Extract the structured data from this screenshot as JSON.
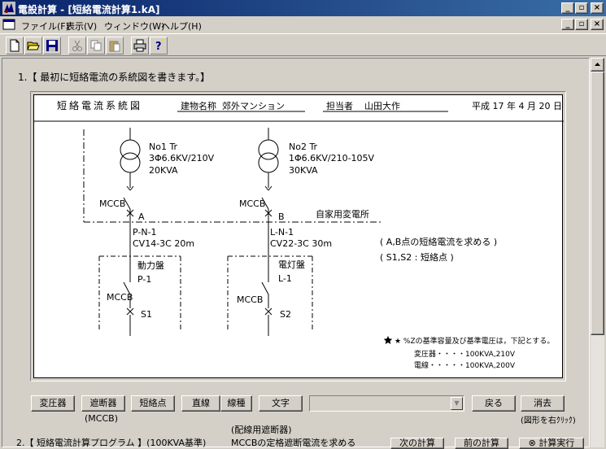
{
  "window": {
    "title": "電設計算 - [短絡電流計算1.kA]",
    "caption_buttons": [
      "_",
      "▫",
      "×"
    ]
  },
  "menu": {
    "items": [
      "ファイル(F)",
      "表示(V)",
      "ウィンドウ(W)",
      "ヘルプ(H)"
    ]
  },
  "toolbar": {
    "buttons": [
      "new-file-icon",
      "open-folder-icon",
      "save-disk-icon",
      "cut-icon",
      "copy-icon",
      "paste-icon",
      "print-icon",
      "help-icon"
    ]
  },
  "section1": {
    "title": "1.【 最初に短絡電流の系統図を書きます。】"
  },
  "diagram": {
    "header": {
      "title": "短絡電流系統図",
      "building_label": "建物名称",
      "building_name": "郊外マンション",
      "person_label": "担当者",
      "person_name": "山田大作",
      "date": "平成 17 年 4 月 20 日"
    },
    "tr1": {
      "name": "No1 Tr",
      "spec": "3Φ6.6KV/210V",
      "capacity": "20KVA"
    },
    "tr2": {
      "name": "No2 Tr",
      "spec": "1Φ6.6KV/210-105V",
      "capacity": "30KVA"
    },
    "mccb": "MCCB",
    "point_a": "A",
    "point_b": "B",
    "substation": "自家用変電所",
    "cable1": {
      "name": "P-N-1",
      "spec": "CV14-3C  20m"
    },
    "cable2": {
      "name": "L-N-1",
      "spec": "CV22-3C  30m"
    },
    "panel1": {
      "name": "動力盤",
      "id": "P-1"
    },
    "panel2": {
      "name": "電灯盤",
      "id": "L-1"
    },
    "s1": "S1",
    "s2": "S2",
    "note1": "( A,B点の短絡電流を求める )",
    "note2": "( S1,S2 : 短絡点 )",
    "basis_note": "★ %Zの基準容量及び基準電圧は，下記とする。",
    "basis_tr": "変圧器・・・・100KVA,210V",
    "basis_wire": "電線・・・・・100KVA,200V"
  },
  "buttons": {
    "transformer": "変圧器",
    "breaker": "遮断器",
    "short_point": "短絡点",
    "line": "直線",
    "line_type": "線種",
    "text": "文字",
    "back": "戻る",
    "erase": "消去",
    "breaker_sub": "(MCCB)",
    "right_click_hint": "(図形を右ｸﾘｯｸ)"
  },
  "section2": {
    "title": "2.【 短絡電流計算プログラム 】(100KVA基準)",
    "breaker_label": "(配線用遮断器)",
    "breaker_desc": "MCCBの定格遮断電流を求める",
    "next_calc": "次の計算",
    "prev_calc": "前の計算",
    "run_calc": "⊗ 計算実行"
  }
}
